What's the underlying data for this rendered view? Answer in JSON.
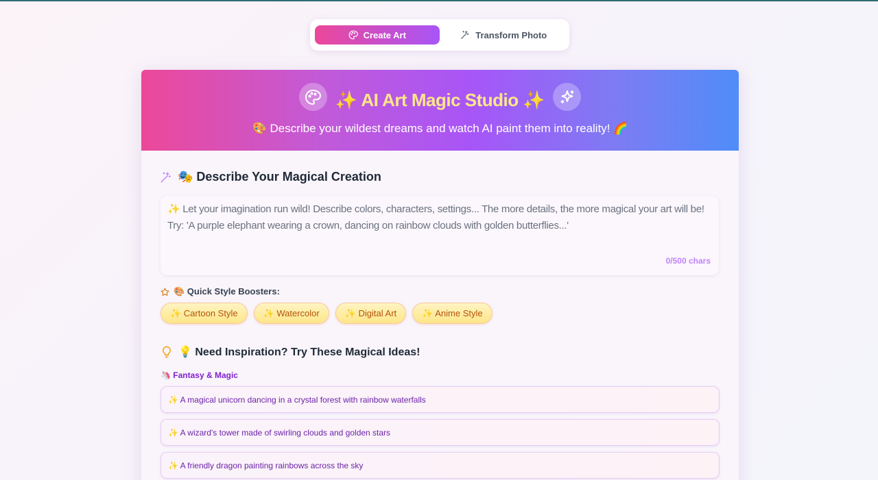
{
  "mode_switch": {
    "create_label": "Create Art",
    "transform_label": "Transform Photo"
  },
  "hero": {
    "title": "✨ AI Art Magic Studio ✨",
    "subtitle": "🎨 Describe your wildest dreams and watch AI paint them into reality! 🌈"
  },
  "describe": {
    "heading": "🎭 Describe Your Magical Creation",
    "placeholder_line1": "✨ Let your imagination run wild! Describe colors, characters, settings... The more details, the more magical your art will be!",
    "placeholder_line2": "Try: 'A purple elephant wearing a crown, dancing on rainbow clouds with golden butterflies...'",
    "char_count": "0/500 chars"
  },
  "boosters": {
    "label": "🎨 Quick Style Boosters:",
    "items": [
      "✨ Cartoon Style",
      "✨ Watercolor",
      "✨ Digital Art",
      "✨ Anime Style"
    ]
  },
  "inspiration": {
    "heading": "💡 Need Inspiration? Try These Magical Ideas!",
    "category": "🦄 Fantasy & Magic",
    "ideas": [
      "✨ A magical unicorn dancing in a crystal forest with rainbow waterfalls",
      "✨ A wizard's tower made of swirling clouds and golden stars",
      "✨ A friendly dragon painting rainbows across the sky"
    ]
  },
  "colors": {
    "accent_pink": "#ec4899",
    "accent_purple": "#a855f7",
    "accent_blue": "#4f8df8",
    "title_yellow": "#fde68a"
  }
}
